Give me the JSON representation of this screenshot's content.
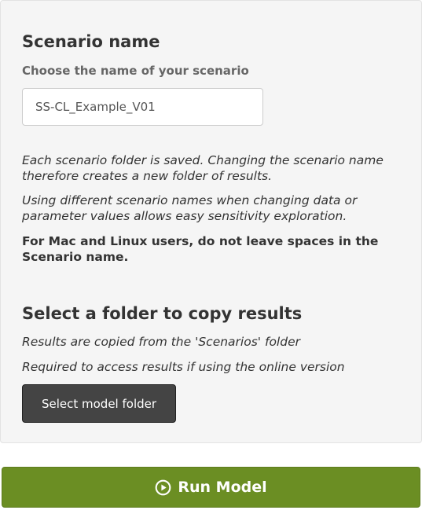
{
  "scenario": {
    "title": "Scenario name",
    "subtitle": "Choose the name of your scenario",
    "input_value": "SS-CL_Example_V01",
    "note1": "Each scenario folder is saved. Changing the scenario name therefore creates a new folder of results.",
    "note2": "Using different scenario names when changing data or parameter values allows easy sensitivity exploration.",
    "note3": "For Mac and Linux users, do not leave spaces in the Scenario name."
  },
  "copy_results": {
    "title": "Select a folder to copy results",
    "note1": "Results are copied from the 'Scenarios' folder",
    "note2": "Required to access results if using the online version",
    "button_label": "Select model folder"
  },
  "run": {
    "label": "Run Model",
    "icon": "play-circle-icon"
  },
  "colors": {
    "run_button": "#6b8e23",
    "folder_button": "#444444",
    "panel": "#f5f5f5"
  }
}
